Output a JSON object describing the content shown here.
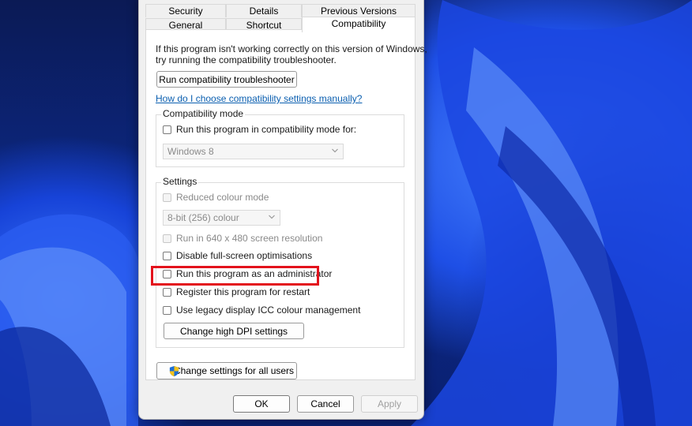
{
  "tabs_row1": [
    {
      "label": "Security"
    },
    {
      "label": "Details"
    },
    {
      "label": "Previous Versions"
    }
  ],
  "tabs_row2": [
    {
      "label": "General"
    },
    {
      "label": "Shortcut"
    },
    {
      "label": "Compatibility"
    }
  ],
  "intro": {
    "line1": "If this program isn't working correctly on this version of Windows,",
    "line2": "try running the compatibility troubleshooter."
  },
  "troubleshooter_button": "Run compatibility troubleshooter",
  "manual_link": "How do I choose compatibility settings manually?",
  "compat_mode": {
    "title": "Compatibility mode",
    "checkbox_label": "Run this program in compatibility mode for:",
    "checked": false,
    "os_selected": "Windows 8"
  },
  "settings": {
    "title": "Settings",
    "reduced_colour": {
      "label": "Reduced colour mode",
      "checked": false
    },
    "colour_depth": "8-bit (256) colour",
    "res_640": {
      "label": "Run in 640 x 480 screen resolution",
      "checked": false
    },
    "disable_fullscreen": {
      "label": "Disable full-screen optimisations",
      "checked": false
    },
    "run_admin": {
      "label": "Run this program as an administrator",
      "checked": false
    },
    "register_restart": {
      "label": "Register this program for restart",
      "checked": false
    },
    "legacy_icc": {
      "label": "Use legacy display ICC colour management",
      "checked": false
    },
    "dpi_button": "Change high DPI settings"
  },
  "all_users_button": "Change settings for all users",
  "footer": {
    "ok": "OK",
    "cancel": "Cancel",
    "apply": "Apply"
  },
  "colors": {
    "highlight": "#e3121c",
    "link": "#0b5fb0"
  }
}
